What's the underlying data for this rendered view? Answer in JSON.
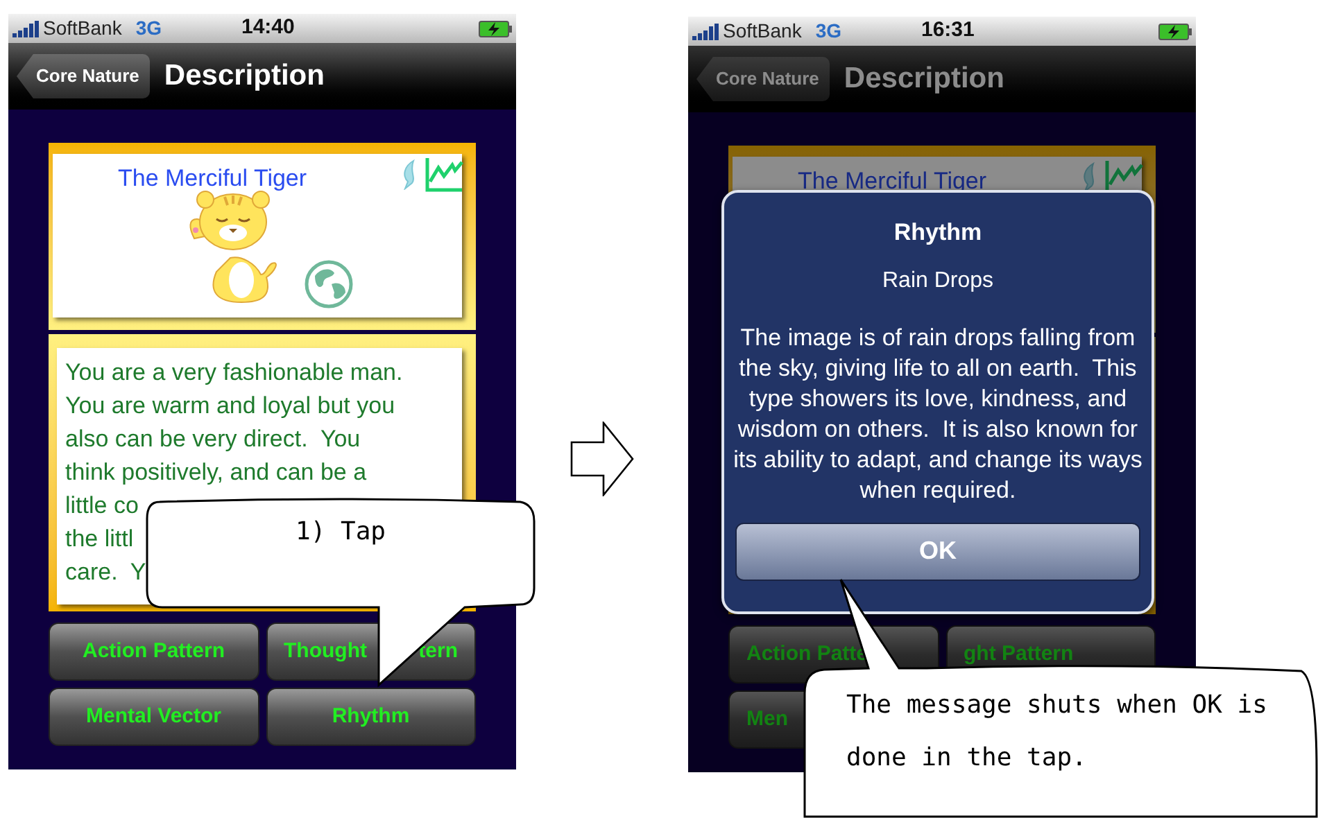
{
  "screens": [
    {
      "status_bar": {
        "carrier": "SoftBank",
        "network": "3G",
        "time": "14:40"
      },
      "nav_bar": {
        "back": "Core Nature",
        "title": "Description"
      },
      "card_title": "The Merciful Tiger",
      "description_lines": [
        "You are a very fashionable man.",
        "You are warm and loyal but you",
        "also can be very direct.  You",
        "think positively, and can be a",
        "little co",
        "the littl",
        "care.  Y"
      ],
      "buttons": [
        {
          "parts": [
            "Action Pattern"
          ]
        },
        {
          "parts": [
            "Thought",
            "tern"
          ]
        },
        {
          "parts": [
            "Mental Vector"
          ]
        },
        {
          "parts": [
            "Rhythm"
          ]
        }
      ]
    },
    {
      "status_bar": {
        "carrier": "SoftBank",
        "network": "3G",
        "time": "16:31"
      },
      "nav_bar": {
        "back": "Core Nature",
        "title": "Description"
      },
      "card_title": "The Merciful Tiger",
      "buttons": [
        {
          "parts": [
            "Action Patte"
          ]
        },
        {
          "parts": [
            "ght Pattern"
          ]
        },
        {
          "parts": [
            "Men"
          ]
        }
      ],
      "alert": {
        "title": "Rhythm",
        "subtitle": "Rain Drops",
        "message": "The image is of rain drops falling from the sky, giving life to all on earth.  This type showers its love, kindness, and wisdom on others.  It is also known for its ability to adapt, and change its ways when required.",
        "button": "OK"
      }
    }
  ],
  "callouts": [
    {
      "text": "1) Tap"
    },
    {
      "text": "The message shuts when OK is done in the tap."
    }
  ]
}
